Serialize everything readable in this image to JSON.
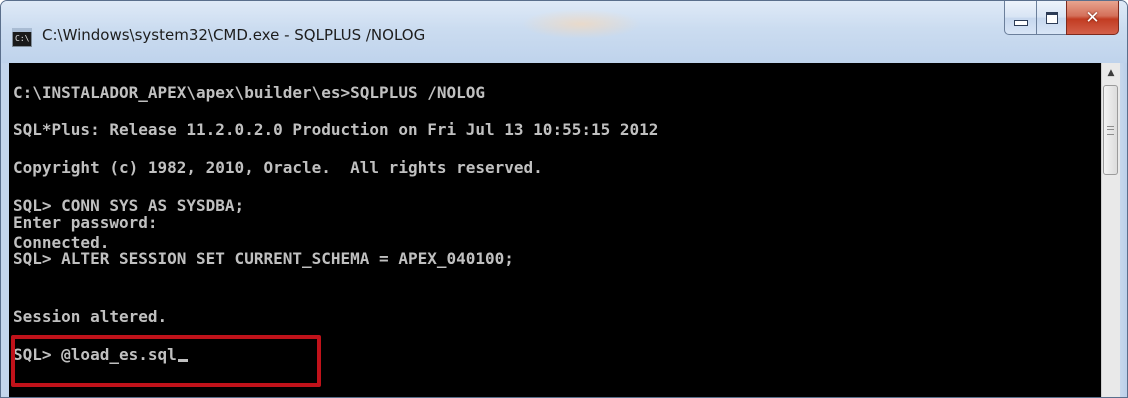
{
  "window": {
    "title": "C:\\Windows\\system32\\CMD.exe - SQLPLUS  /NOLOG",
    "icon_label": "C:\\",
    "controls": {
      "minimize_icon": "minimize-icon",
      "maximize_icon": "maximize-icon",
      "close_icon": "close-icon",
      "close_glyph": "✕"
    }
  },
  "console": {
    "lines": [
      "C:\\INSTALADOR_APEX\\apex\\builder\\es>SQLPLUS /NOLOG",
      "SQL*Plus: Release 11.2.0.2.0 Production on Fri Jul 13 10:55:15 2012",
      "Copyright (c) 1982, 2010, Oracle.  All rights reserved.",
      "SQL> CONN SYS AS SYSDBA;",
      "Enter password:",
      "Connected.",
      "SQL> ALTER SESSION SET CURRENT_SCHEMA = APEX_040100;",
      "Session altered.",
      "SQL> @load_es.sql"
    ],
    "colors": {
      "background": "#000000",
      "text": "#c0c0c0",
      "highlight_border": "#c0121a"
    }
  },
  "scrollbar": {
    "up_arrow": "▲"
  }
}
